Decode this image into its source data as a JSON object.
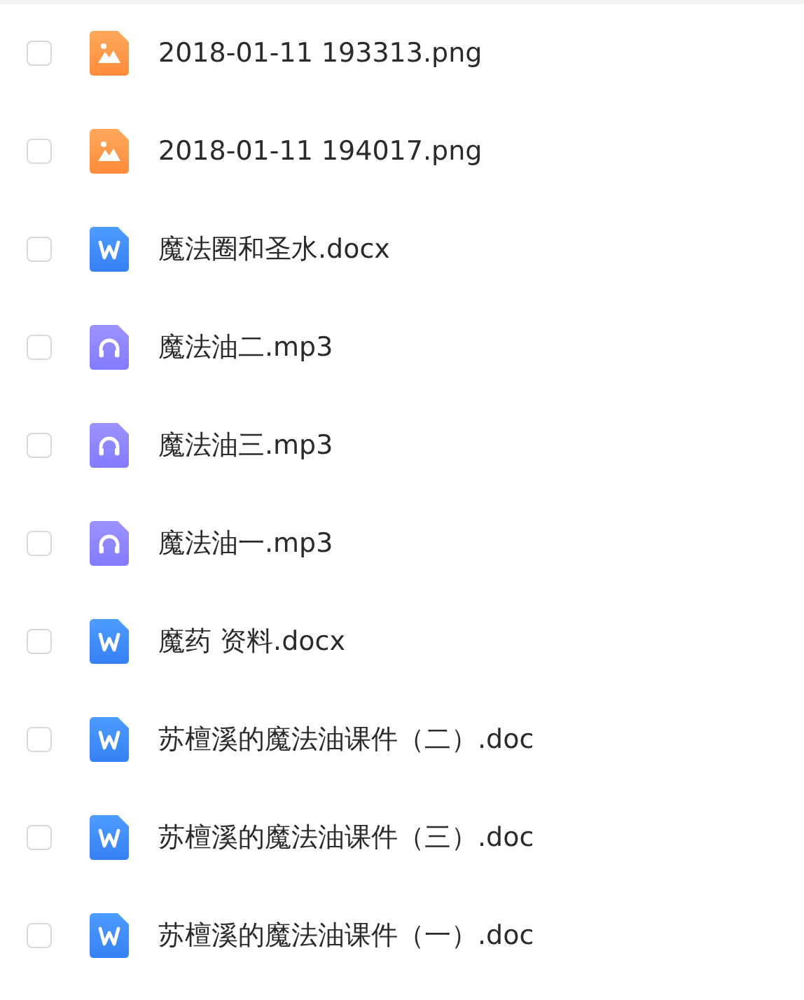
{
  "files": [
    {
      "name": "2018-01-11 193313.png",
      "kind": "image",
      "checked": false
    },
    {
      "name": "2018-01-11 194017.png",
      "kind": "image",
      "checked": false
    },
    {
      "name": "魔法圈和圣水.docx",
      "kind": "word",
      "checked": false
    },
    {
      "name": "魔法油二.mp3",
      "kind": "audio",
      "checked": false
    },
    {
      "name": "魔法油三.mp3",
      "kind": "audio",
      "checked": false
    },
    {
      "name": "魔法油一.mp3",
      "kind": "audio",
      "checked": false
    },
    {
      "name": "魔药 资料.docx",
      "kind": "word",
      "checked": false
    },
    {
      "name": "苏檀溪的魔法油课件（二）.doc",
      "kind": "word",
      "checked": false
    },
    {
      "name": "苏檀溪的魔法油课件（三）.doc",
      "kind": "word",
      "checked": false
    },
    {
      "name": "苏檀溪的魔法油课件（一）.doc",
      "kind": "word",
      "checked": false
    }
  ]
}
